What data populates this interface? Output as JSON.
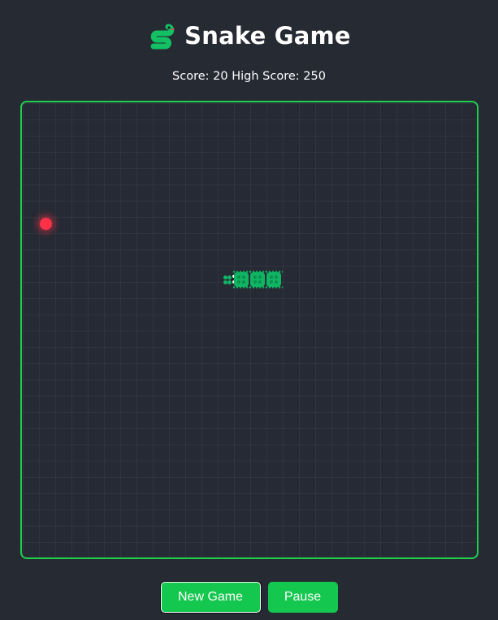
{
  "header": {
    "title": "Snake Game",
    "icon": "snake-icon"
  },
  "scoreboard": {
    "text": "Score: 20 High Score: 250",
    "score": 20,
    "high_score": 250
  },
  "board": {
    "grid_cells": 28,
    "food": {
      "cell": [
        1,
        7
      ]
    },
    "snake": {
      "direction": "left",
      "length": 4,
      "head_cell": [
        12,
        11
      ],
      "body_cells": [
        [
          13,
          11
        ],
        [
          14,
          11
        ],
        [
          15,
          11
        ]
      ]
    }
  },
  "controls": {
    "new_game_label": "New Game",
    "pause_label": "Pause"
  },
  "colors": {
    "background": "#262a33",
    "board_border": "#1fcf4c",
    "snake": "#10b563",
    "food": "#ff3048",
    "button": "#14c74e"
  }
}
